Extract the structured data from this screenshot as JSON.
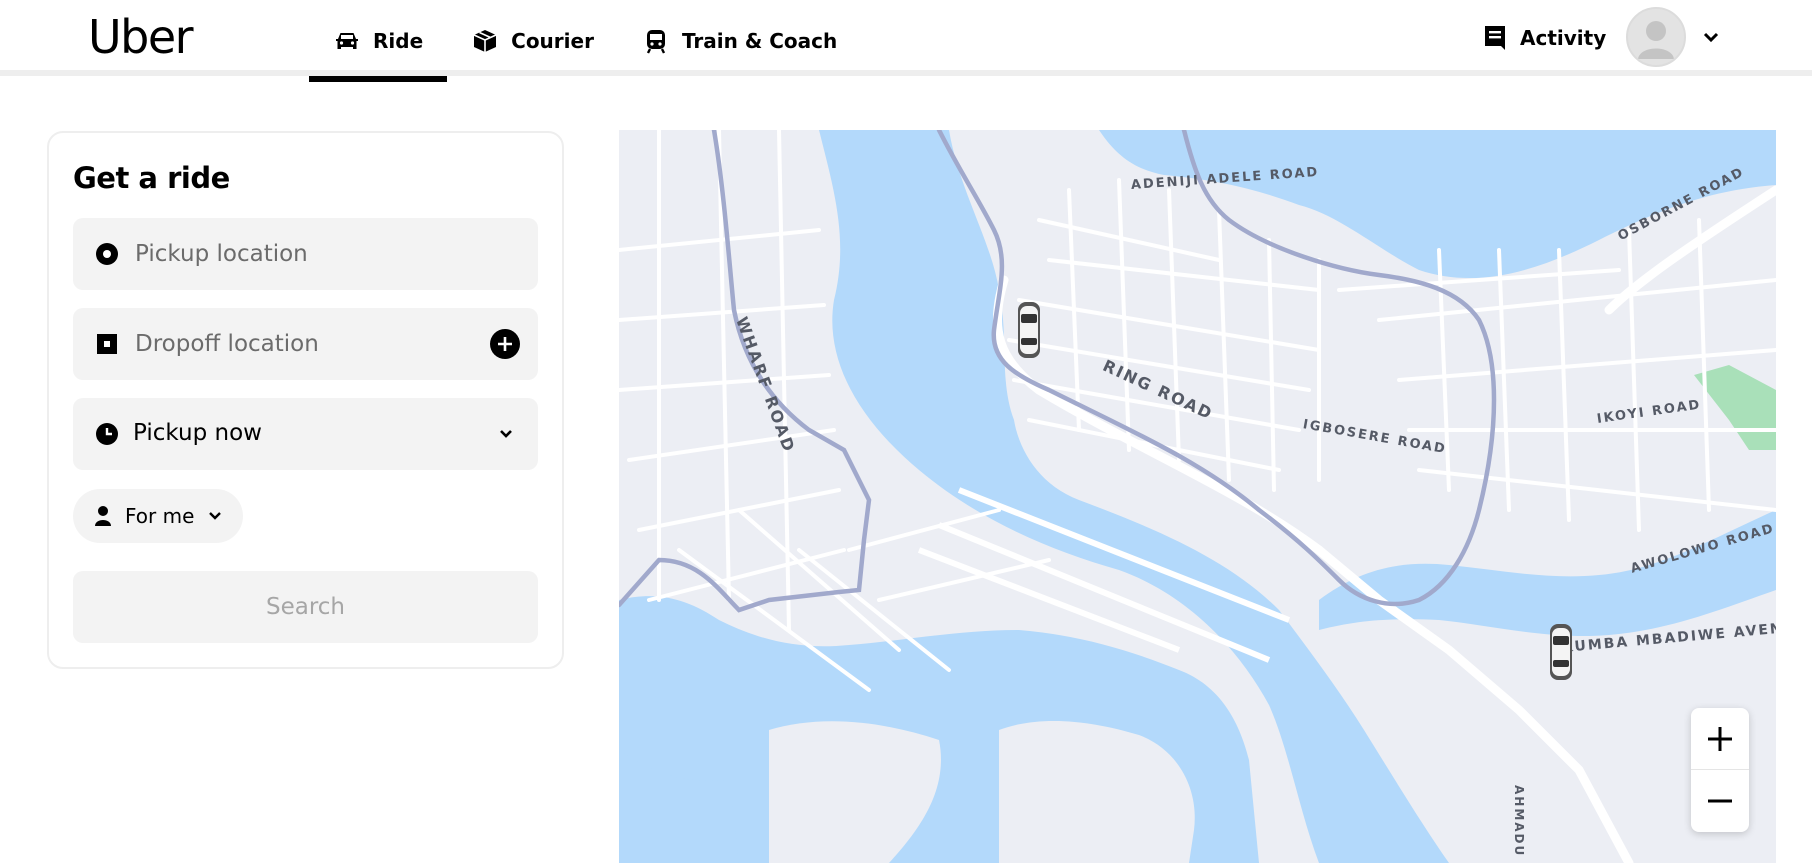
{
  "header": {
    "logo": "Uber",
    "nav": [
      {
        "label": "Ride",
        "icon": "car-icon",
        "active": true
      },
      {
        "label": "Courier",
        "icon": "box-icon",
        "active": false
      },
      {
        "label": "Train & Coach",
        "icon": "train-icon",
        "active": false
      }
    ],
    "activity_label": "Activity"
  },
  "panel": {
    "title": "Get a ride",
    "pickup_placeholder": "Pickup location",
    "dropoff_placeholder": "Dropoff location",
    "time_label": "Pickup now",
    "rider_label": "For me",
    "search_label": "Search"
  },
  "map": {
    "road_labels": {
      "adeniji": "ADENIJI ADELE ROAD",
      "osborne": "OSBORNE ROAD",
      "wharf": "WHARF ROAD",
      "ring": "RING ROAD",
      "igbosere": "IGBOSERE ROAD",
      "ikoyi": "IKOYI ROAD",
      "awolowo": "AWOLOWO ROAD",
      "mbadiwe": "KUMBA MBADIWE AVEN",
      "ahmadu": "AHMADU BE"
    },
    "colors": {
      "water": "#b3d9fb",
      "land": "#eceef4",
      "road": "#ffffff",
      "route": "#a1a9cc",
      "park": "#a9e0b9"
    }
  }
}
